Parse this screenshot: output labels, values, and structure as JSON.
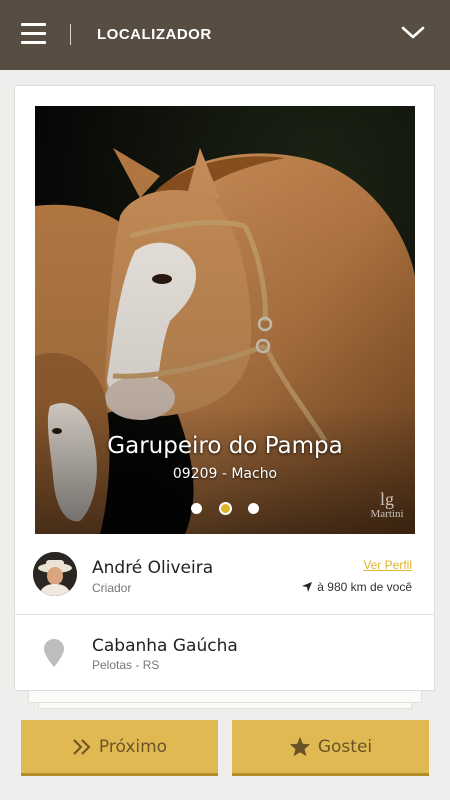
{
  "header": {
    "title": "LOCALIZADOR",
    "menu_icon": "hamburger-menu-icon",
    "dropdown_icon": "chevron-down-icon"
  },
  "horse": {
    "name": "Garupeiro do Pampa",
    "subtitle": "09209 - Macho",
    "watermark": "Martini",
    "photo_count": 3,
    "active_photo": 2
  },
  "owner": {
    "name": "André Oliveira",
    "role": "Criador",
    "profile_link": "Ver Perfil",
    "distance": "à 980 km de você"
  },
  "farm": {
    "name": "Cabanha Gaúcha",
    "location": "Pelotas - RS"
  },
  "actions": {
    "next_label": "Próximo",
    "like_label": "Gostei"
  },
  "colors": {
    "topbar": "#574d42",
    "accent": "#e1b52b",
    "button": "#e1b952",
    "background": "#efeeec"
  }
}
